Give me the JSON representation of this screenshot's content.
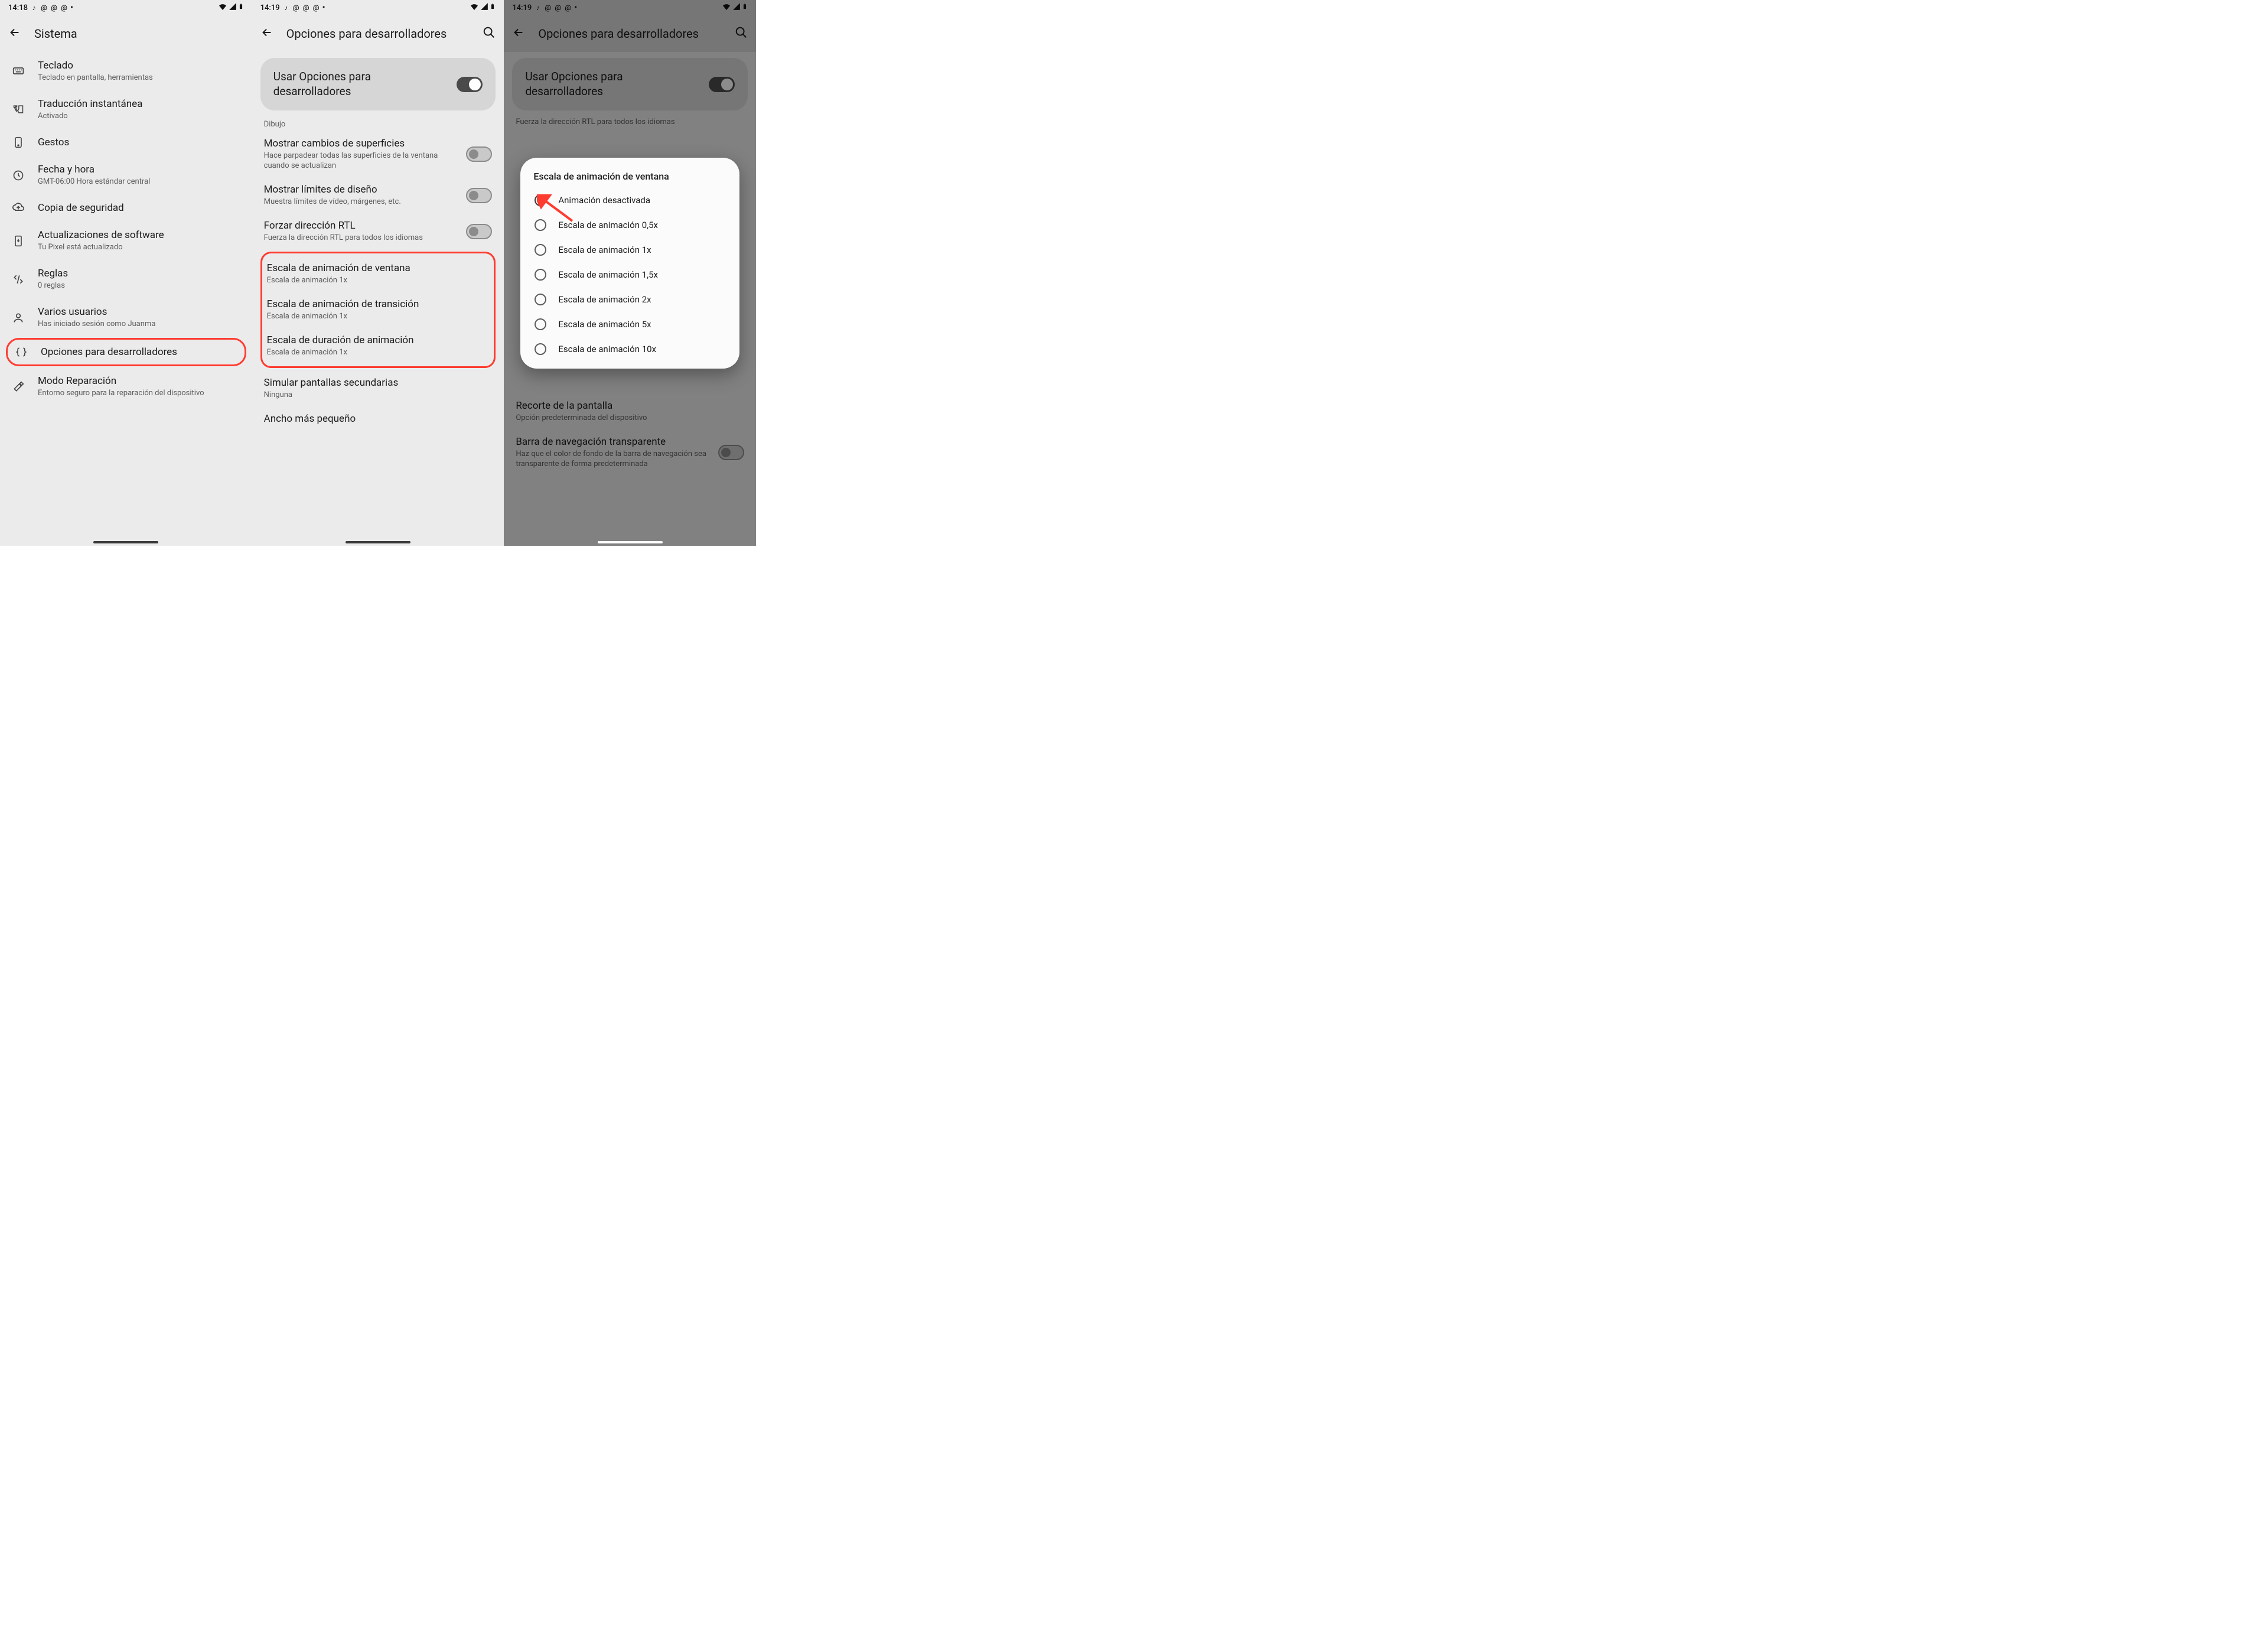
{
  "screen1": {
    "time": "14:18",
    "title": "Sistema",
    "items": [
      {
        "title": "Teclado",
        "subtitle": "Teclado en pantalla, herramientas"
      },
      {
        "title": "Traducción instantánea",
        "subtitle": "Activado"
      },
      {
        "title": "Gestos",
        "subtitle": ""
      },
      {
        "title": "Fecha y hora",
        "subtitle": "GMT-06:00 Hora estándar central"
      },
      {
        "title": "Copia de seguridad",
        "subtitle": ""
      },
      {
        "title": "Actualizaciones de software",
        "subtitle": "Tu Pixel está actualizado"
      },
      {
        "title": "Reglas",
        "subtitle": "0 reglas"
      },
      {
        "title": "Varios usuarios",
        "subtitle": "Has iniciado sesión como Juanma"
      },
      {
        "title": "Opciones para desarrolladores",
        "subtitle": ""
      },
      {
        "title": "Modo Reparación",
        "subtitle": "Entorno seguro para la reparación del dispositivo"
      }
    ]
  },
  "screen2": {
    "time": "14:19",
    "title": "Opciones para desarrolladores",
    "master_toggle": "Usar Opciones para desarrolladores",
    "section": "Dibujo",
    "rows": [
      {
        "title": "Mostrar cambios de superficies",
        "subtitle": "Hace parpadear todas las superficies de la ventana cuando se actualizan"
      },
      {
        "title": "Mostrar límites de diseño",
        "subtitle": "Muestra límites de vídeo, márgenes, etc."
      },
      {
        "title": "Forzar dirección RTL",
        "subtitle": "Fuerza la dirección RTL para todos los idiomas"
      }
    ],
    "highlighted": [
      {
        "title": "Escala de animación de ventana",
        "subtitle": "Escala de animación 1x"
      },
      {
        "title": "Escala de animación de transición",
        "subtitle": "Escala de animación 1x"
      },
      {
        "title": "Escala de duración de animación",
        "subtitle": "Escala de animación 1x"
      }
    ],
    "after": [
      {
        "title": "Simular pantallas secundarias",
        "subtitle": "Ninguna"
      },
      {
        "title": "Ancho más pequeño",
        "subtitle": ""
      }
    ]
  },
  "screen3": {
    "time": "14:19",
    "title": "Opciones para desarrolladores",
    "master_toggle": "Usar Opciones para desarrolladores",
    "bg_row_top": "Fuerza la dirección RTL para todos los idiomas",
    "bg_rows": [
      {
        "title": "Recorte de la pantalla",
        "subtitle": "Opción predeterminada del dispositivo"
      },
      {
        "title": "Barra de navegación transparente",
        "subtitle": "Haz que el color de fondo de la barra de navegación sea transparente de forma predeterminada"
      }
    ],
    "dialog": {
      "title": "Escala de animación de ventana",
      "options": [
        {
          "label": "Animación desactivada",
          "selected": true
        },
        {
          "label": "Escala de animación 0,5x",
          "selected": false
        },
        {
          "label": "Escala de animación 1x",
          "selected": false
        },
        {
          "label": "Escala de animación 1,5x",
          "selected": false
        },
        {
          "label": "Escala de animación 2x",
          "selected": false
        },
        {
          "label": "Escala de animación 5x",
          "selected": false
        },
        {
          "label": "Escala de animación 10x",
          "selected": false
        }
      ]
    }
  }
}
